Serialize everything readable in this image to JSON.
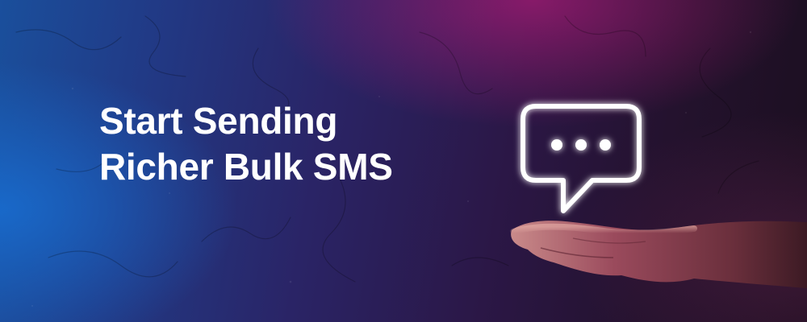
{
  "banner": {
    "headline_line1": "Start Sending",
    "headline_line2": "Richer Bulk SMS",
    "icon": "chat-bubble-typing-icon",
    "hand_image": "open-hand-palm-up"
  },
  "colors": {
    "text": "#ffffff",
    "gradient_left": "#1a4f9c",
    "gradient_mid": "#2a2466",
    "gradient_right": "#1b0f1f",
    "glow_magenta": "#c41c80"
  }
}
